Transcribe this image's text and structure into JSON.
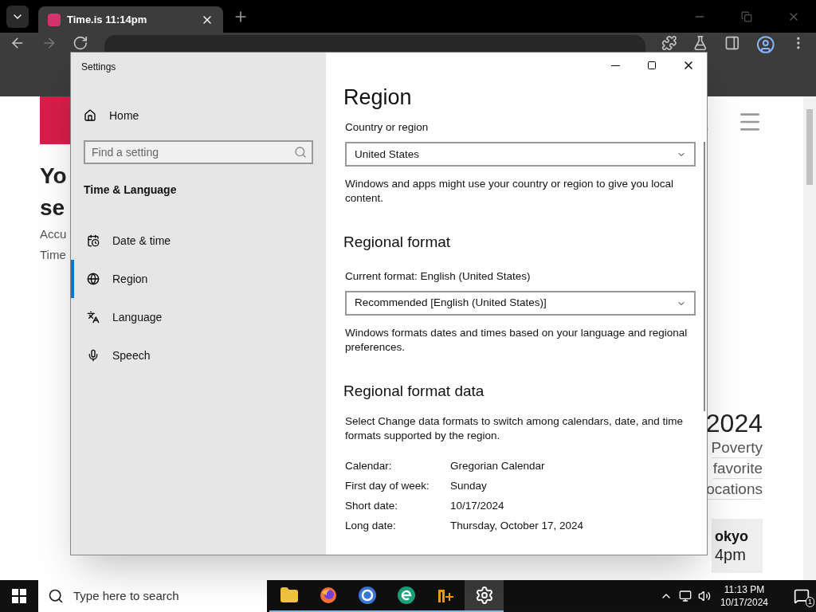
{
  "browser": {
    "tab_title": "Time.is 11:14pm",
    "page": {
      "left": [
        {
          "kind": "heading",
          "text": "Yo"
        },
        {
          "kind": "heading",
          "text": "se"
        },
        {
          "kind": "line",
          "text": "Accu"
        },
        {
          "kind": "line",
          "text": "Time"
        }
      ],
      "right": {
        "year": "2024",
        "links": [
          "Poverty",
          "favorite",
          "ocations"
        ],
        "card_city": "okyo",
        "card_time": "4pm"
      }
    }
  },
  "settings": {
    "title": "Settings",
    "home": "Home",
    "search_placeholder": "Find a setting",
    "section": "Time & Language",
    "nav": [
      {
        "kind": "date",
        "label": "Date & time",
        "selected": false
      },
      {
        "kind": "region",
        "label": "Region",
        "selected": true
      },
      {
        "kind": "language",
        "label": "Language",
        "selected": false
      },
      {
        "kind": "speech",
        "label": "Speech",
        "selected": false
      }
    ],
    "content": {
      "title": "Region",
      "country_label": "Country or region",
      "country_value": "United States",
      "country_note": "Windows and apps might use your country or region to give you local content.",
      "format_heading": "Regional format",
      "current_format": "Current format: English (United States)",
      "format_value": "Recommended [English (United States)]",
      "format_note": "Windows formats dates and times based on your language and regional preferences.",
      "data_heading": "Regional format data",
      "data_note": "Select Change data formats to switch among calendars, date, and time formats supported by the region.",
      "rows": [
        {
          "label": "Calendar:",
          "value": "Gregorian Calendar"
        },
        {
          "label": "First day of week:",
          "value": "Sunday"
        },
        {
          "label": "Short date:",
          "value": "10/17/2024"
        },
        {
          "label": "Long date:",
          "value": "Thursday, October 17, 2024"
        }
      ]
    }
  },
  "taskbar": {
    "search_placeholder": "Type here to search",
    "apps": [
      {
        "kind": "folder",
        "running": true,
        "active": false
      },
      {
        "kind": "firefox",
        "running": true,
        "active": false
      },
      {
        "kind": "chrome",
        "running": true,
        "active": false
      },
      {
        "kind": "edge",
        "running": true,
        "active": false
      },
      {
        "kind": "nplus",
        "running": true,
        "active": false
      },
      {
        "kind": "settings",
        "running": true,
        "active": true
      }
    ],
    "time": "11:13 PM",
    "date": "10/17/2024",
    "notifications": "1"
  }
}
